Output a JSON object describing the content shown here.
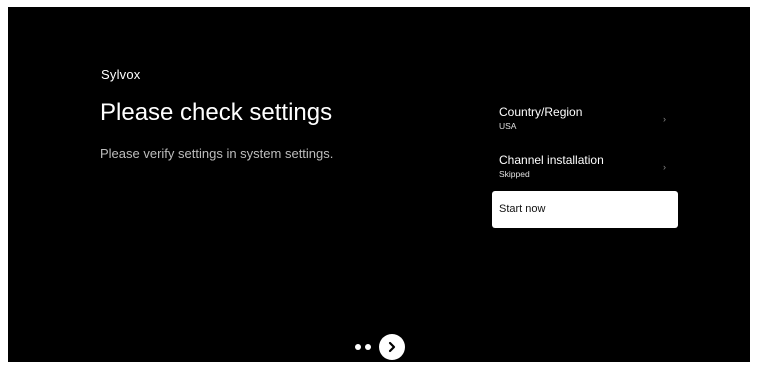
{
  "brand": {
    "logo_text": "Sylvox"
  },
  "header": {
    "title": "Please check settings",
    "subtitle": "Please verify settings in system settings."
  },
  "settings": {
    "items": [
      {
        "label": "Country/Region",
        "value": "USA",
        "chevron": "chevron-right-icon"
      },
      {
        "label": "Channel installation",
        "value": "Skipped",
        "chevron": "chevron-right-icon"
      }
    ],
    "start_label": "Start now"
  },
  "pager": {
    "dots": 2,
    "next_icon": "chevron-right-icon"
  },
  "colors": {
    "background": "#000000",
    "text": "#ffffff",
    "muted_text": "#bdbdbd",
    "focus_button_bg": "#ffffff",
    "focus_button_text": "#111111"
  }
}
